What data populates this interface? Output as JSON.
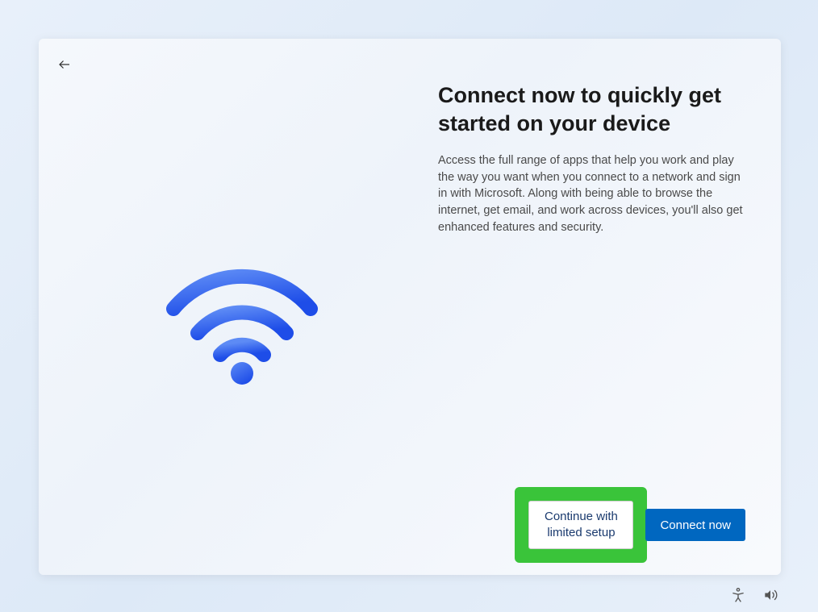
{
  "heading": "Connect now to quickly get started on your device",
  "body_text": "Access the full range of apps that help you work and play the way you want when you connect to a network and sign in with Microsoft. Along with being able to browse the internet, get email, and work across devices, you'll also get enhanced features and security.",
  "buttons": {
    "continue_limited": "Continue with limited setup",
    "connect_now": "Connect now"
  },
  "colors": {
    "primary_button": "#0067c0",
    "highlight_border": "#3ac43a",
    "wifi_gradient_top": "#4a7ff0",
    "wifi_gradient_bottom": "#1a4de0"
  }
}
